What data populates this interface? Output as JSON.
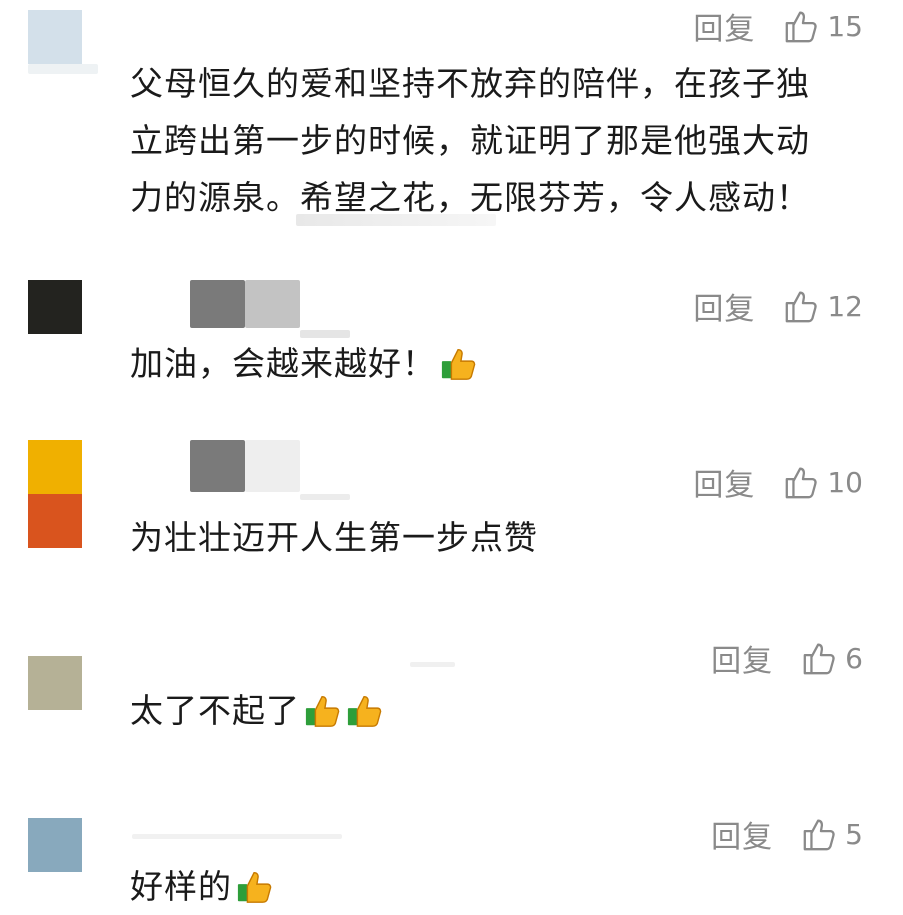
{
  "comments": [
    {
      "reply_label": "回复",
      "likes": "15",
      "text": "父母恒久的爱和坚持不放弃的陪伴，在孩子独立跨出第一步的时候，就证明了那是他强大动力的源泉。希望之花，无限芬芳，令人感动！",
      "avatar_colors": [
        "#d3e0ea"
      ]
    },
    {
      "reply_label": "回复",
      "likes": "12",
      "text": "加油，会越来越好！",
      "emoji_count": 1,
      "avatar_colors": [
        "#23231f"
      ]
    },
    {
      "reply_label": "回复",
      "likes": "10",
      "text": "为壮壮迈开人生第一步点赞",
      "avatar_colors": [
        "#f0b000",
        "#d9541e"
      ]
    },
    {
      "reply_label": "回复",
      "likes": "6",
      "text": "太了不起了",
      "emoji_count": 2,
      "avatar_colors": [
        "#b5b196"
      ]
    },
    {
      "reply_label": "回复",
      "likes": "5",
      "text": "好样的",
      "emoji_count": 1,
      "avatar_colors": [
        "#88a9bd"
      ]
    }
  ],
  "icons": {
    "like": "thumbs-up-outline-icon",
    "emoji": "thumbs-up-emoji-icon"
  },
  "colors": {
    "muted": "#8a8a8a",
    "text": "#1a1a1a"
  }
}
